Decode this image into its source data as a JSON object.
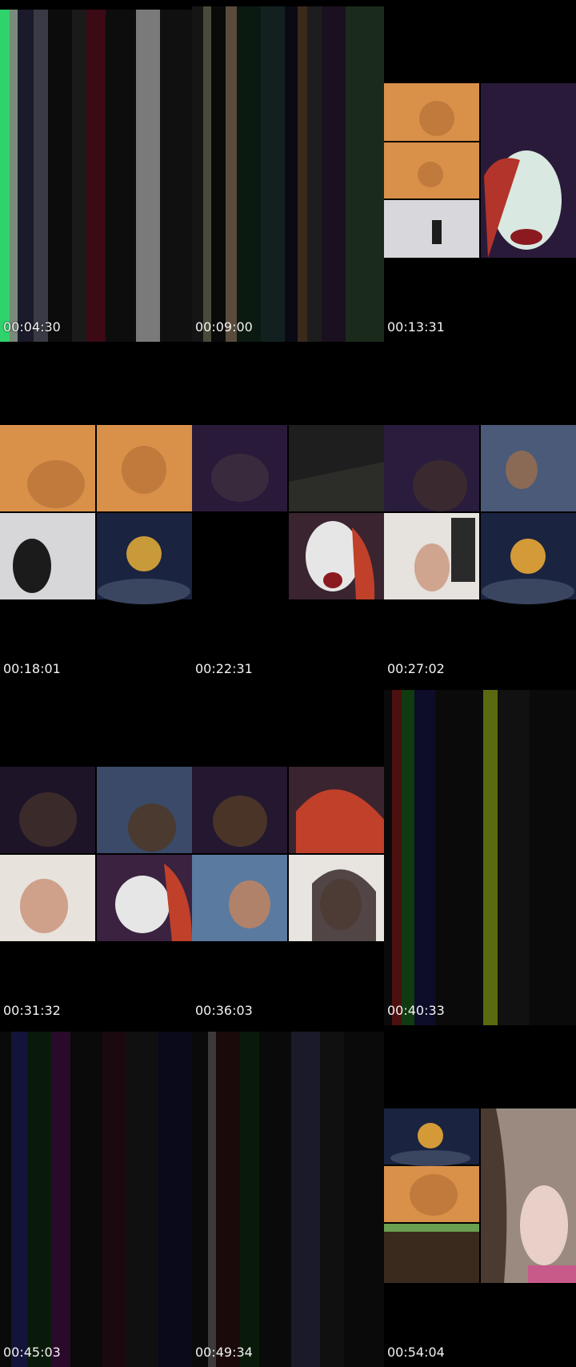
{
  "thumbnails": [
    {
      "time": "00:04:30",
      "kind": "stripes",
      "palette": [
        "#2fd36b",
        "#6d6d6d",
        "#24243a",
        "#0c0c0c",
        "#3b0a14",
        "#777",
        "#151515",
        "#0b0b0b"
      ]
    },
    {
      "time": "00:09:00",
      "kind": "stripes",
      "palette": [
        "#111",
        "#5a4b3c",
        "#0b1a10",
        "#122020",
        "#0a0a14",
        "#3a2a1c",
        "#0f0f0f",
        "#1b2b1b"
      ]
    },
    {
      "time": "00:13:31",
      "kind": "collage-a"
    },
    {
      "time": "00:18:01",
      "kind": "collage-b"
    },
    {
      "time": "00:22:31",
      "kind": "collage-c"
    },
    {
      "time": "00:27:02",
      "kind": "collage-d"
    },
    {
      "time": "00:31:32",
      "kind": "collage-e"
    },
    {
      "time": "00:36:03",
      "kind": "collage-f"
    },
    {
      "time": "00:40:33",
      "kind": "stripes",
      "palette": [
        "#0a0a0a",
        "#4b1010",
        "#103a10",
        "#0d0d2a",
        "#0a0a0a",
        "#5a6a10",
        "#111",
        "#0a0a0a"
      ]
    },
    {
      "time": "00:45:03",
      "kind": "stripes",
      "palette": [
        "#0a0a0a",
        "#14143a",
        "#0a1a0a",
        "#2a0a2a",
        "#0a0a0a",
        "#101010",
        "#1a0a0a",
        "#0a0a1a"
      ]
    },
    {
      "time": "00:49:34",
      "kind": "stripes",
      "palette": [
        "#0a0a0a",
        "#2a2a2a",
        "#1a0a0a",
        "#0a1a0a",
        "#0a0a0a",
        "#1a1a2a",
        "#101010",
        "#0a0a0a"
      ]
    },
    {
      "time": "00:54:04",
      "kind": "collage-g"
    }
  ],
  "colors": {
    "background": "#000000",
    "gingerbread": "#d9914a",
    "night_sky": "#1a2440",
    "timestamp": "#f2f2f2"
  }
}
